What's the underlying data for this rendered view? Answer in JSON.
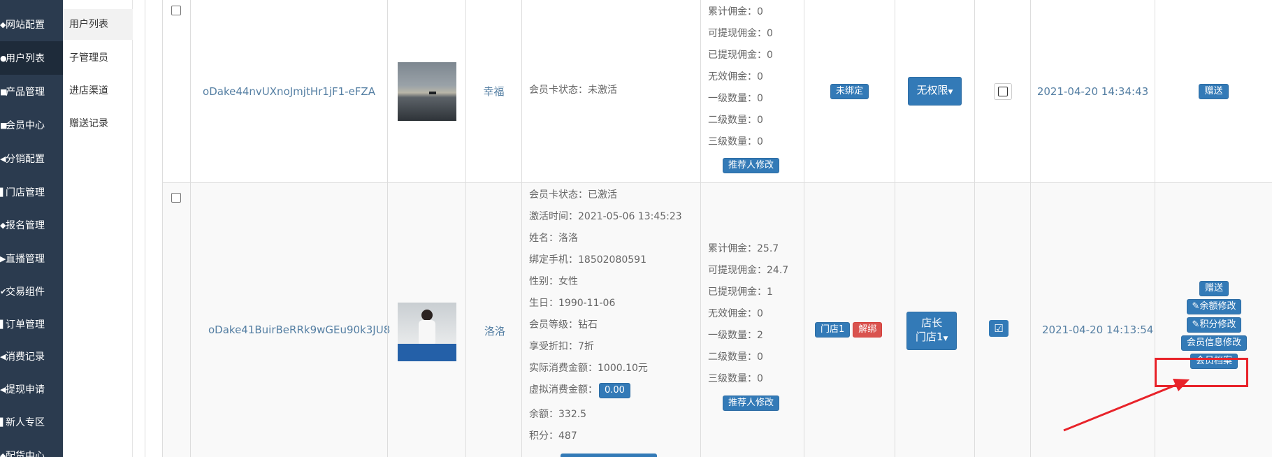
{
  "sidebar": {
    "items": [
      {
        "icon": "gear-icon",
        "label": "网站配置"
      },
      {
        "icon": "user-icon",
        "label": "用户列表"
      },
      {
        "icon": "product-icon",
        "label": "产品管理"
      },
      {
        "icon": "member-icon",
        "label": "会员中心"
      },
      {
        "icon": "share-icon",
        "label": "分销配置"
      },
      {
        "icon": "store-icon",
        "label": "门店管理"
      },
      {
        "icon": "signup-icon",
        "label": "报名管理"
      },
      {
        "icon": "live-icon",
        "label": "直播管理"
      },
      {
        "icon": "trade-icon",
        "label": "交易组件"
      },
      {
        "icon": "order-icon",
        "label": "订单管理"
      },
      {
        "icon": "record-icon",
        "label": "消费记录"
      },
      {
        "icon": "withdraw-icon",
        "label": "提现申请"
      },
      {
        "icon": "newcomer-icon",
        "label": "新人专区"
      },
      {
        "icon": "delivery-icon",
        "label": "配货中心"
      }
    ]
  },
  "subnav": {
    "items": [
      "用户列表",
      "子管理员",
      "进店渠道",
      "赠送记录"
    ]
  },
  "rows": [
    {
      "openid": "oDake44nvUXnoJmjtHr1jF1-eFZA",
      "name": "幸福",
      "card": [
        "会员卡状态：未激活"
      ],
      "commission": [
        "累计佣金：0",
        "可提现佣金：0",
        "已提现佣金：0",
        "无效佣金：0",
        "一级数量：0",
        "二级数量：0",
        "三级数量：0"
      ],
      "referrer_btn": "推荐人修改",
      "store_tags": [
        "未绑定"
      ],
      "role_btn": "无权限",
      "checked": false,
      "time": "2021-04-20 14:34:43",
      "actions": [
        "赠送"
      ]
    },
    {
      "openid": "oDake41BuirBeRRk9wGEu90k3JU8",
      "name": "洛洛",
      "card": [
        "会员卡状态：已激活",
        "激活时间：2021-05-06 13:45:23",
        "姓名：洛洛",
        "绑定手机：18502080591",
        "性别：女性",
        "生日：1990-11-06",
        "会员等级：钻石",
        "享受折扣：7折",
        "实际消费金额：1000.10元"
      ],
      "virtual_label": "虚拟消费金额：",
      "virtual_value": "0.00",
      "card_tail": [
        "余额：332.5",
        "积分：487"
      ],
      "commission": [
        "累计佣金：25.7",
        "可提现佣金：24.7",
        "已提现佣金：1",
        "无效佣金：0",
        "一级数量：2",
        "二级数量：0",
        "三级数量：0"
      ],
      "referrer_btn": "推荐人修改",
      "store_tag": "门店1",
      "unbind_btn": "解绑",
      "role_line1": "店长",
      "role_line2": "门店1",
      "checked": true,
      "time": "2021-04-20 14:13:54",
      "actions": [
        "赠送",
        "余额修改",
        "积分修改",
        "会员信息修改",
        "会员档案"
      ]
    }
  ],
  "colors": {
    "sidebar_bg": "#2b3b4f",
    "primary": "#337ab7",
    "danger": "#d9534f",
    "highlight": "#e8232a"
  }
}
